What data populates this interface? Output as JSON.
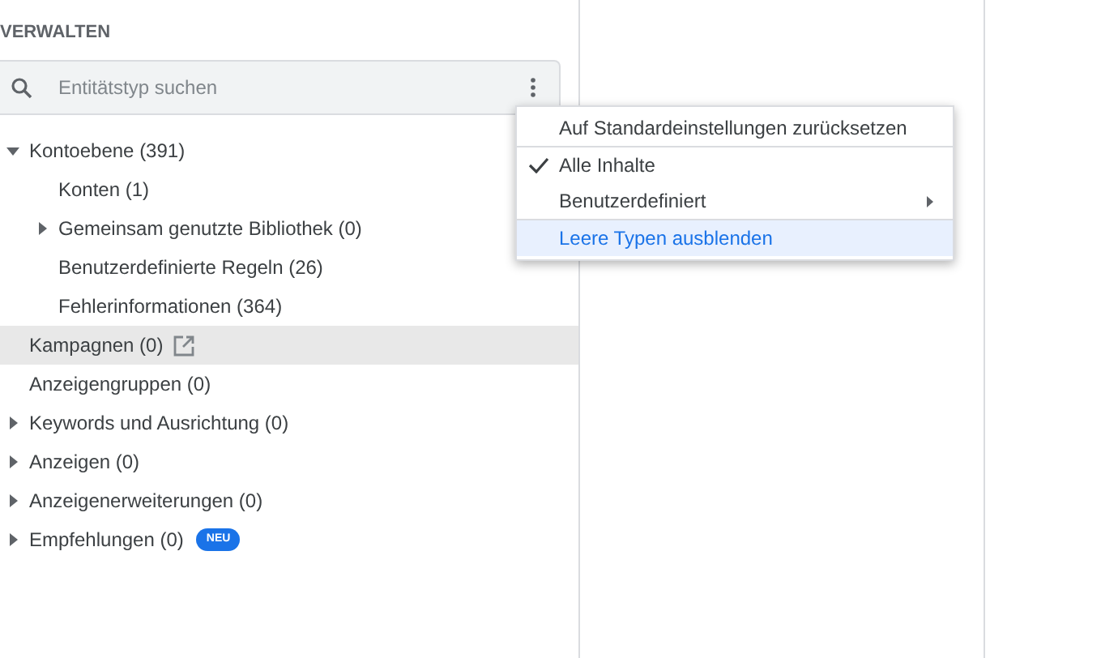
{
  "section_title": "VERWALTEN",
  "search": {
    "placeholder": "Entitätstyp suchen"
  },
  "tree": [
    {
      "label": "Kontoebene (391)",
      "expanded": true,
      "selected": false,
      "children": [
        {
          "label": "Konten (1)",
          "selected": false
        },
        {
          "label": "Gemeinsam genutzte Bibliothek (0)",
          "expanded": false,
          "selected": false
        },
        {
          "label": "Benutzerdefinierte Regeln (26)",
          "selected": false
        },
        {
          "label": "Fehlerinformationen (364)",
          "selected": false
        }
      ]
    },
    {
      "label": "Kampagnen (0)",
      "selected": true,
      "external_link": true
    },
    {
      "label": "Anzeigengruppen (0)",
      "selected": false
    },
    {
      "label": "Keywords und Ausrichtung (0)",
      "expanded": false,
      "selected": false
    },
    {
      "label": "Anzeigen (0)",
      "expanded": false,
      "selected": false
    },
    {
      "label": "Anzeigenerweiterungen (0)",
      "expanded": false,
      "selected": false
    },
    {
      "label": "Empfehlungen (0)",
      "expanded": false,
      "selected": false,
      "badge": "NEU"
    }
  ],
  "menu": {
    "groups": [
      [
        {
          "label": "Auf Standardeinstellungen zurücksetzen",
          "checked": false,
          "selected": false
        }
      ],
      [
        {
          "label": "Alle Inhalte",
          "checked": true,
          "selected": false
        },
        {
          "label": "Benutzerdefiniert",
          "checked": false,
          "selected": false,
          "submenu": true
        }
      ],
      [
        {
          "label": "Leere Typen ausblenden",
          "checked": false,
          "selected": true
        }
      ]
    ]
  }
}
